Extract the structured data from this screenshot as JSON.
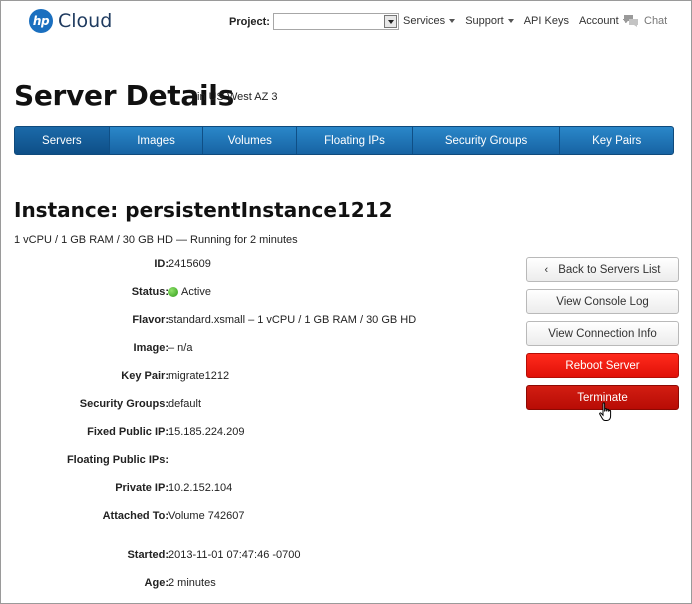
{
  "header": {
    "logo_mark": "hp",
    "logo_text": "Cloud",
    "project_label": "Project:",
    "project_value": "",
    "nav": [
      {
        "label": "Services",
        "dropdown": true
      },
      {
        "label": "Support",
        "dropdown": true
      },
      {
        "label": "API Keys",
        "dropdown": false
      },
      {
        "label": "Account",
        "dropdown": true
      }
    ],
    "chat_label": "Chat"
  },
  "page": {
    "title": "Server Details",
    "region": "in US West AZ 3"
  },
  "tabs": [
    {
      "label": "Servers",
      "active": true
    },
    {
      "label": "Images",
      "active": false
    },
    {
      "label": "Volumes",
      "active": false
    },
    {
      "label": "Floating IPs",
      "active": false
    },
    {
      "label": "Security Groups",
      "active": false
    },
    {
      "label": "Key Pairs",
      "active": false
    }
  ],
  "instance": {
    "title": "Instance: persistentInstance1212",
    "summary": "1 vCPU / 1 GB RAM / 30 GB HD — Running for 2 minutes"
  },
  "details": [
    {
      "label": "ID:",
      "value": "2415609"
    },
    {
      "label": "Status:",
      "value": "Active"
    },
    {
      "label": "Flavor:",
      "value": "standard.xsmall – 1 vCPU / 1 GB RAM / 30 GB HD"
    },
    {
      "label": "Image:",
      "value": "– n/a"
    },
    {
      "label": "Key Pair:",
      "value": "migrate1212"
    },
    {
      "label": "Security Groups:",
      "value": "default"
    },
    {
      "label": "Fixed Public IP:",
      "value": "15.185.224.209"
    },
    {
      "label": "Floating Public IPs:",
      "value": ""
    },
    {
      "label": "Private IP:",
      "value": "10.2.152.104"
    },
    {
      "label": "Attached To:",
      "value": "Volume 742607"
    },
    {
      "label": "Started:",
      "value": "2013-11-01 07:47:46 -0700"
    },
    {
      "label": "Age:",
      "value": "2 minutes"
    }
  ],
  "actions": {
    "back": "Back to Servers List",
    "back_icon": "chevron-left-icon",
    "console_log": "View Console Log",
    "connection_info": "View Connection Info",
    "reboot": "Reboot Server",
    "terminate": "Terminate"
  },
  "colors": {
    "tab_bar": "#1a6fb5",
    "reboot": "#f51a0f",
    "terminate": "#c8120a",
    "status_active": "#3aa81f",
    "logo": "#1a6fbf"
  }
}
